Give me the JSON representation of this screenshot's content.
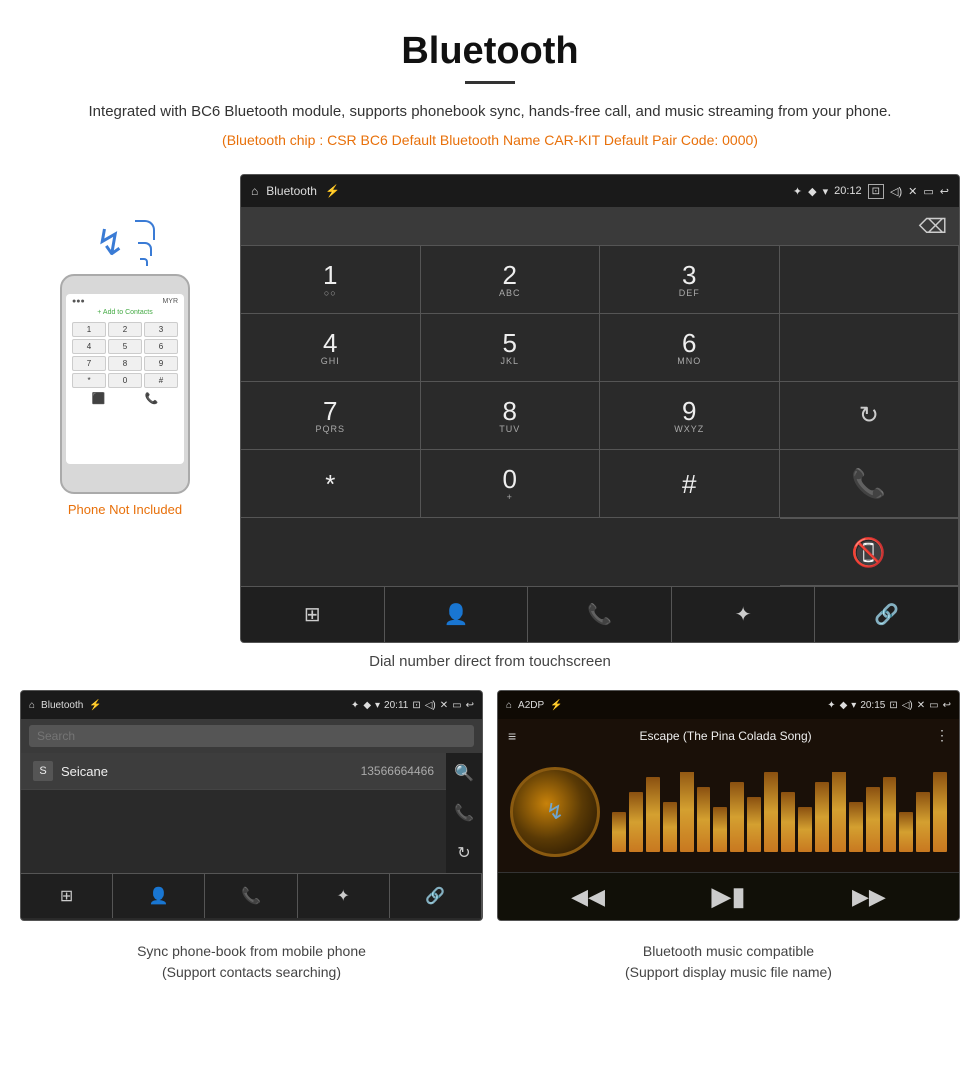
{
  "header": {
    "title": "Bluetooth",
    "description": "Integrated with BC6 Bluetooth module, supports phonebook sync, hands-free call, and music streaming from your phone.",
    "specs": "(Bluetooth chip : CSR BC6    Default Bluetooth Name CAR-KIT    Default Pair Code: 0000)"
  },
  "dial_screen": {
    "statusbar": {
      "app_name": "Bluetooth",
      "time": "20:12",
      "usb_icon": "⚡",
      "bt_icon": "✦",
      "location_icon": "◆",
      "wifi_icon": "▼",
      "camera_icon": "⊡",
      "volume_icon": "◁)",
      "close_icon": "✕",
      "rect_icon": "▭",
      "back_icon": "↩"
    },
    "keys": [
      {
        "num": "1",
        "sub": "○○"
      },
      {
        "num": "2",
        "sub": "ABC"
      },
      {
        "num": "3",
        "sub": "DEF"
      },
      {
        "num": "4",
        "sub": "GHI"
      },
      {
        "num": "5",
        "sub": "JKL"
      },
      {
        "num": "6",
        "sub": "MNO"
      },
      {
        "num": "7",
        "sub": "PQRS"
      },
      {
        "num": "8",
        "sub": "TUV"
      },
      {
        "num": "9",
        "sub": "WXYZ"
      },
      {
        "num": "*",
        "sub": ""
      },
      {
        "num": "0",
        "sub": "+"
      },
      {
        "num": "#",
        "sub": ""
      }
    ],
    "bottom_icons": [
      "⊞",
      "👤",
      "📞",
      "✦",
      "🔗"
    ],
    "caption": "Dial number direct from touchscreen"
  },
  "phonebook_screen": {
    "statusbar": {
      "app_name": "Bluetooth",
      "time": "20:11"
    },
    "search_placeholder": "Search",
    "contacts": [
      {
        "letter": "S",
        "name": "Seicane",
        "number": "13566664466"
      }
    ],
    "caption": "Sync phone-book from mobile phone\n(Support contacts searching)"
  },
  "music_screen": {
    "statusbar": {
      "app_name": "A2DP",
      "time": "20:15"
    },
    "song_title": "Escape (The Pina Colada Song)",
    "caption": "Bluetooth music compatible\n(Support display music file name)"
  },
  "phone_not_included": "Phone Not Included",
  "music_bars": [
    40,
    60,
    75,
    50,
    85,
    65,
    45,
    70,
    55,
    80,
    60,
    45,
    70,
    85,
    50,
    65,
    75,
    40,
    60,
    80
  ]
}
